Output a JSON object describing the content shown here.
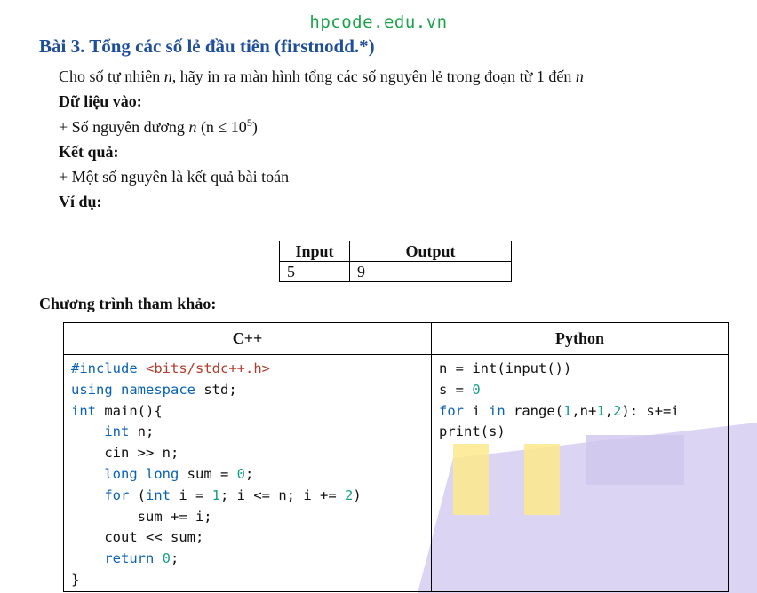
{
  "site": "hpcode.edu.vn",
  "title": "Bài 3. Tổng các số lẻ đầu tiên (firstnodd.*)",
  "statement": {
    "before": "Cho số tự nhiên ",
    "var": "n",
    "mid": ", hãy in ra màn hình tổng các số nguyên lẻ trong đoạn từ 1 đến ",
    "var2": "n"
  },
  "input_heading": "Dữ liệu vào:",
  "input_desc": {
    "before": "+ Số nguyên dương ",
    "var": "n",
    "cond": " (n ≤ 10",
    "exp": "5",
    "close": ")"
  },
  "output_heading": "Kết quả:",
  "output_desc": "+ Một số nguyên là kết quả bài toán",
  "example_heading": "Ví dụ:",
  "example": {
    "headers": [
      "Input",
      "Output"
    ],
    "rows": [
      [
        "5",
        "9"
      ]
    ]
  },
  "program_heading": "Chương trình tham khảo:",
  "code_headers": [
    "C++",
    "Python"
  ],
  "watermark_colors": {
    "yellow": "#fde98c",
    "purple": "#cfc6ee"
  }
}
